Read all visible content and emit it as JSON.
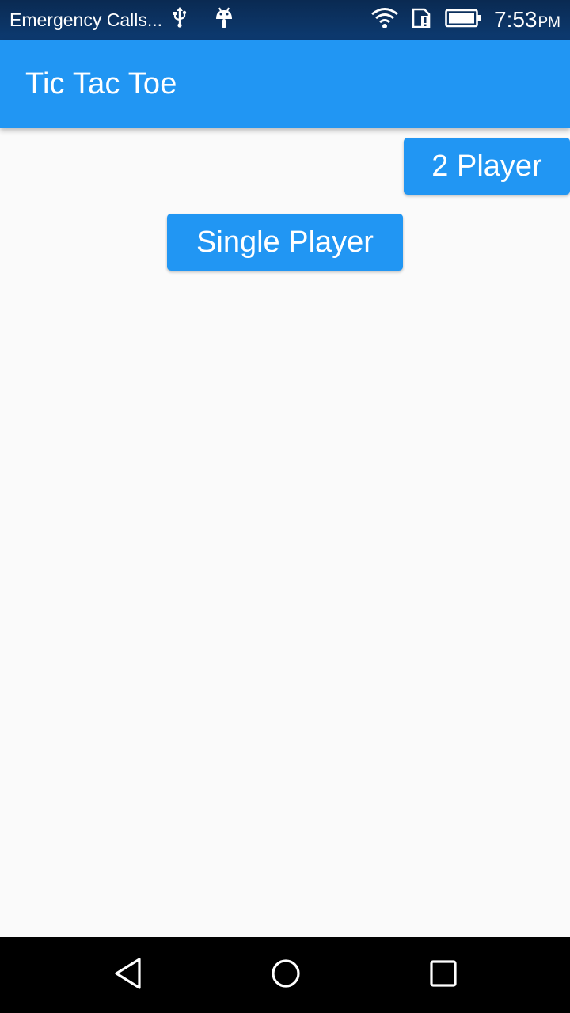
{
  "status_bar": {
    "carrier_text": "Emergency Calls...",
    "time": "7:53",
    "ampm": "PM",
    "icons": [
      "usb-icon",
      "android-debug-icon",
      "wifi-icon",
      "sim-alert-icon",
      "battery-icon"
    ]
  },
  "app_bar": {
    "title": "Tic Tac Toe",
    "color": "#2196f3"
  },
  "main": {
    "two_player_label": "2 Player",
    "single_player_label": "Single Player",
    "button_color": "#2196f3",
    "background": "#fafafa"
  },
  "nav_bar": {
    "icons": [
      "back-icon",
      "home-icon",
      "recents-icon"
    ]
  }
}
